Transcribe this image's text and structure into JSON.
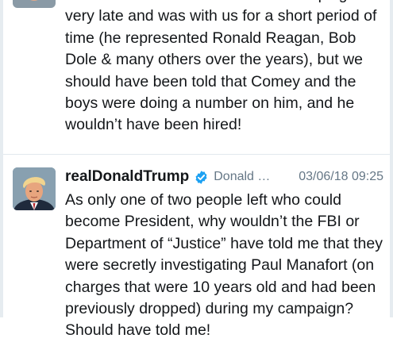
{
  "tweets": [
    {
      "text": "Mr. Paul Manafort came into the campaign very late and was with us for a short period of time (he represented Ronald Reagan, Bob Dole & many others over the years), but we should have been told that Comey and the boys were doing a number on him, and he wouldn’t have been hired!"
    },
    {
      "display_name": "realDonaldTrump",
      "screen_name": "Donald …",
      "timestamp": "03/06/18 09:25",
      "text": "As only one of two people left who could become President, why wouldn’t the FBI or Department of “Justice” have told me that they were secretly investigating Paul Manafort (on charges that were 10 years old and had been previously dropped) during my campaign? Should have told me!"
    }
  ],
  "colors": {
    "text": "#14171a",
    "muted": "#657786",
    "verified": "#1da1f2",
    "border": "#e6ecf0"
  },
  "icons": {
    "verified": "verified-badge-icon",
    "avatar": "avatar"
  }
}
